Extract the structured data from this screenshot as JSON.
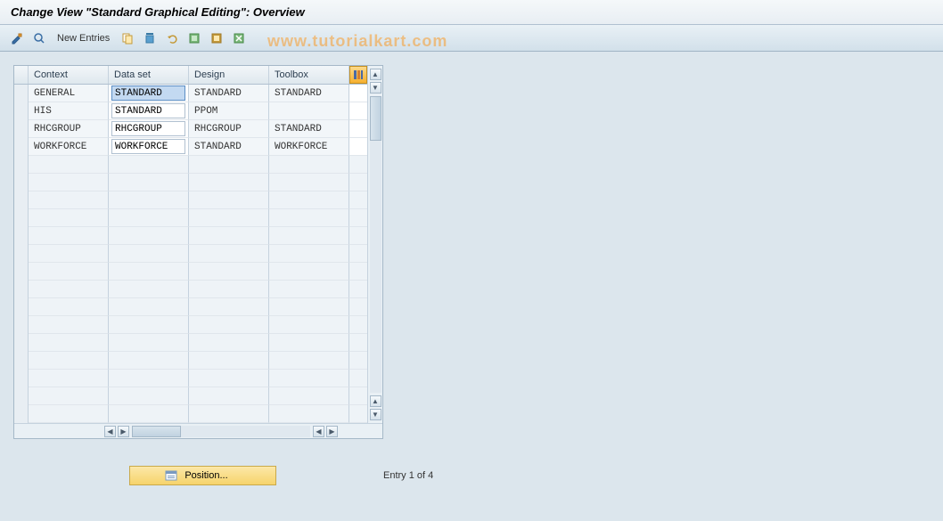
{
  "title": "Change View \"Standard Graphical Editing\": Overview",
  "toolbar": {
    "new_entries": "New Entries"
  },
  "watermark": "www.tutorialkart.com",
  "table": {
    "headers": {
      "context": "Context",
      "dataset": "Data set",
      "design": "Design",
      "toolbox": "Toolbox"
    },
    "rows": [
      {
        "context": "GENERAL",
        "dataset": "STANDARD",
        "design": "STANDARD",
        "toolbox": "STANDARD",
        "selected_col": "dataset"
      },
      {
        "context": "HIS",
        "dataset": "STANDARD",
        "design": "PPOM",
        "toolbox": ""
      },
      {
        "context": "RHCGROUP",
        "dataset": "RHCGROUP",
        "design": "RHCGROUP",
        "toolbox": "STANDARD"
      },
      {
        "context": "WORKFORCE",
        "dataset": "WORKFORCE",
        "design": "STANDARD",
        "toolbox": "WORKFORCE"
      }
    ],
    "empty_rows": 15
  },
  "footer": {
    "position_label": "Position...",
    "entry_text": "Entry 1 of 4"
  }
}
